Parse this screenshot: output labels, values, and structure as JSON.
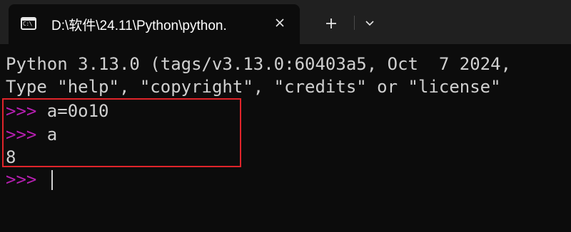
{
  "tab": {
    "icon": "command-prompt-icon",
    "icon_glyph": "C:\\",
    "title": "D:\\软件\\24.11\\Python\\python."
  },
  "toolbar": {
    "new_tab_icon": "plus-icon",
    "dropdown_icon": "chevron-down-icon",
    "close_icon": "close-icon"
  },
  "terminal": {
    "banner_line1": "Python 3.13.0 (tags/v3.13.0:60403a5, Oct  7 2024,",
    "banner_line2": "Type \"help\", \"copyright\", \"credits\" or \"license\"",
    "prompt": ">>>",
    "input1": " a=0o10",
    "input2": " a",
    "output1": "8"
  },
  "colors": {
    "background": "#0c0c0c",
    "tab_strip": "#202020",
    "text": "#d0d0d0",
    "prompt": "#b61fb1",
    "highlight_border": "#e0242a"
  }
}
